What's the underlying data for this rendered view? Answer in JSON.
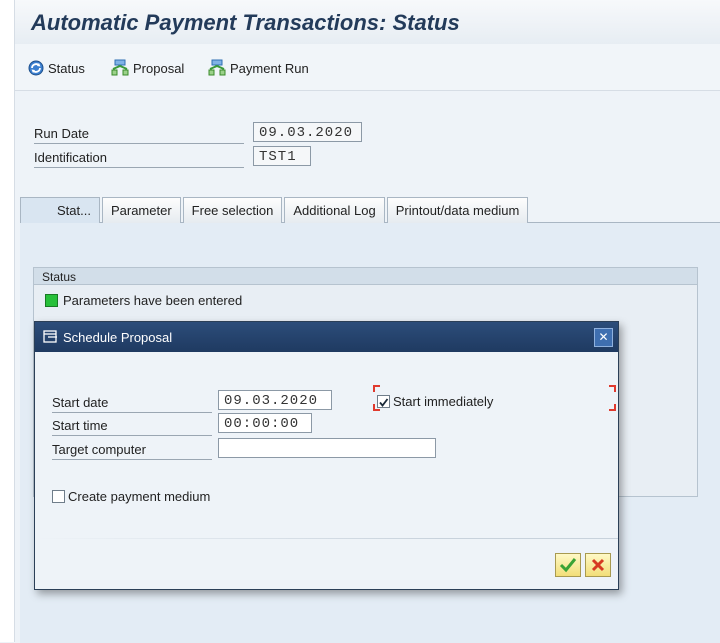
{
  "window": {
    "title": "Automatic Payment Transactions: Status"
  },
  "toolbar": {
    "status_label": "Status",
    "proposal_label": "Proposal",
    "payment_run_label": "Payment Run"
  },
  "header_fields": {
    "run_date_label": "Run Date",
    "run_date_value": "09.03.2020",
    "identification_label": "Identification",
    "identification_value": "TST1"
  },
  "tabs": [
    {
      "label": "Stat...",
      "active": true
    },
    {
      "label": "Parameter"
    },
    {
      "label": "Free selection"
    },
    {
      "label": "Additional Log"
    },
    {
      "label": "Printout/data medium"
    }
  ],
  "status_panel": {
    "header": "Status",
    "message": "Parameters have been entered",
    "indicator_color": "#27c03a"
  },
  "dialog": {
    "title": "Schedule Proposal",
    "start_date_label": "Start date",
    "start_date_value": "09.03.2020",
    "start_time_label": "Start time",
    "start_time_value": "00:00:00",
    "target_computer_label": "Target computer",
    "target_computer_value": "",
    "start_immediately_label": "Start immediately",
    "start_immediately_checked": true,
    "create_payment_medium_label": "Create payment medium",
    "create_payment_medium_checked": false,
    "close_icon": "close-icon",
    "ok_icon": "checkmark-icon",
    "cancel_icon": "cancel-x-icon"
  },
  "colors": {
    "title_text": "#233b5a",
    "dialog_title_bg": "#1f3a61",
    "ok_check": "#3aa335",
    "cancel_x": "#d63a22"
  }
}
